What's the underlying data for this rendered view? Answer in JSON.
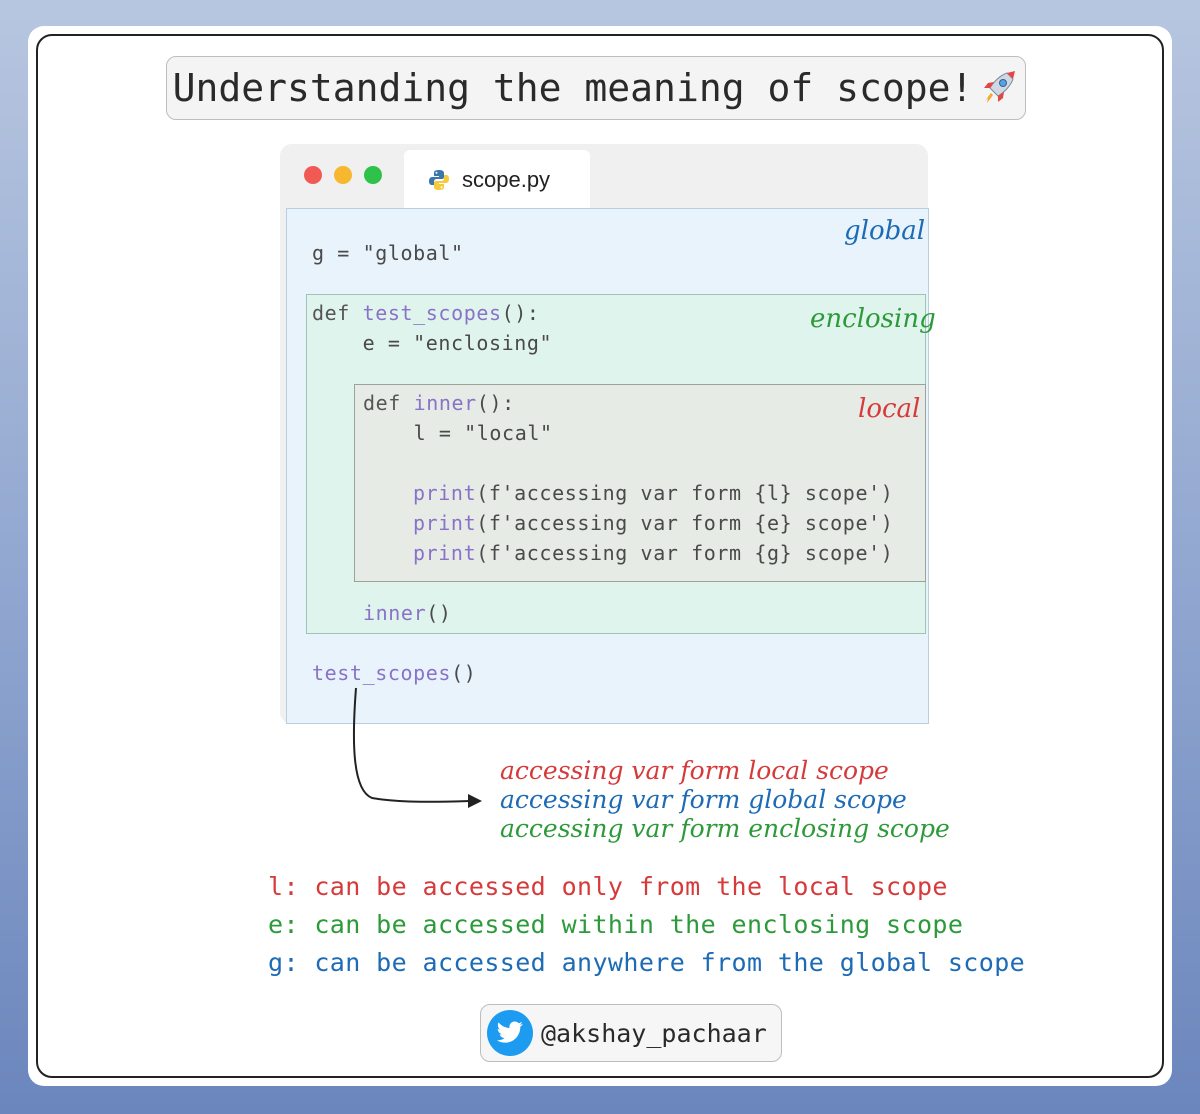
{
  "title": "Understanding the meaning of scope!",
  "title_icon": "rocket-icon",
  "window": {
    "tab_label": "scope.py",
    "tab_icon": "python-icon",
    "traffic_lights": [
      "#f05a52",
      "#f5b82e",
      "#2fc24a"
    ]
  },
  "scope_labels": {
    "global": "global",
    "enclosing": "enclosing",
    "local": "local"
  },
  "code": {
    "line1": "g = \"global\"",
    "line2_kw": "def ",
    "line2_fn": "test_scopes",
    "line2_rest": "():",
    "line3": "    e = \"enclosing\"",
    "line4_kw": "def ",
    "line4_fn": "inner",
    "line4_rest": "():",
    "line5": "    l = \"local\"",
    "print_fn": "print",
    "print1_rest": "(f'accessing var form {l} scope')",
    "print2_rest": "(f'accessing var form {e} scope')",
    "print3_rest": "(f'accessing var form {g} scope')",
    "inner_call_fn": "inner",
    "inner_call_rest": "()",
    "outer_call_fn": "test_scopes",
    "outer_call_rest": "()"
  },
  "output": [
    "accessing var form local scope",
    "accessing var form global scope",
    "accessing var form enclosing scope"
  ],
  "notes": [
    "l: can be accessed only from the local scope",
    "e: can be accessed within the enclosing scope",
    "g: can be accessed anywhere from the global scope"
  ],
  "author": {
    "handle": "@akshay_pachaar",
    "icon": "twitter-icon"
  },
  "colors": {
    "local": "#d63a3a",
    "enclosing": "#2d9a3a",
    "global": "#1d6bb5"
  }
}
